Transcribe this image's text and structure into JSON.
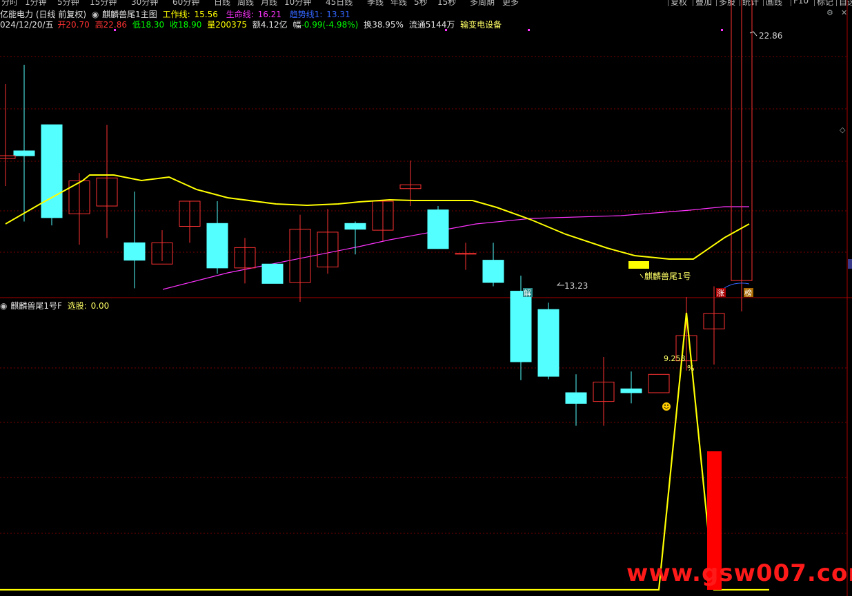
{
  "toolbar": {
    "timeframes": [
      "分时",
      "1分钟",
      "5分钟",
      "15分钟",
      "30分钟",
      "60分钟",
      "日线",
      "周线",
      "月线",
      "10分钟",
      "45日线",
      "季线",
      "年线",
      "5秒",
      "15秒",
      "多周期",
      "更多"
    ],
    "buttons": [
      "复权",
      "叠加",
      "多股",
      "统计",
      "画线",
      "F10",
      "标记",
      "自选"
    ]
  },
  "header": {
    "stock_name": "亿能电力",
    "period": "(日线 前复权)",
    "indicator_name": "麒麟兽尾1主图",
    "lines": [
      {
        "label": "工作线:",
        "value": "15.56",
        "color": "#ffff00"
      },
      {
        "label": "生命线:",
        "value": "16.21",
        "color": "#ff33ff"
      },
      {
        "label": "趋势线1:",
        "value": "13.31",
        "color": "#3366ff"
      }
    ]
  },
  "quote": {
    "date": "024/12/20/五",
    "open_label": "开",
    "open": "20.70",
    "high_label": "高",
    "high": "22.86",
    "low_label": "低",
    "low": "18.30",
    "close_label": "收",
    "close": "18.90",
    "vol_label": "量",
    "vol": "200375",
    "amt_label": "额",
    "amt": "4.12亿",
    "chg_label": "幅",
    "chg": "-0.99(-4.98%)",
    "turnover_label": "换",
    "turnover": "38.95%",
    "float_label": "流通",
    "float": "5144万",
    "industry": "输变电设备"
  },
  "sub_header": {
    "name": "麒麟兽尾1号F",
    "label": "选股:",
    "value": "0.00"
  },
  "colors": {
    "up": "#ff3232",
    "down": "#54ffff",
    "work_line": "#ffff00",
    "life_line": "#ff33ff",
    "trend_line": "#3366ff",
    "grid": "#7a0000",
    "accent_text": "#ffff66"
  },
  "chart_data": [
    {
      "type": "candlestick",
      "candles": [
        {
          "o": 16.55,
          "h": 17.44,
          "l": 15.82,
          "c": 16.5
        },
        {
          "o": 16.82,
          "h": 16.82,
          "l": 15.78,
          "c": 15.86
        },
        {
          "o": 15.9,
          "h": 16.32,
          "l": 15.58,
          "c": 16.24
        },
        {
          "o": 15.98,
          "h": 16.82,
          "l": 15.65,
          "c": 16.27
        },
        {
          "o": 15.6,
          "h": 16.13,
          "l": 15.13,
          "c": 15.42
        },
        {
          "o": 15.38,
          "h": 15.73,
          "l": 15.41,
          "c": 15.6
        },
        {
          "o": 15.77,
          "h": 16.03,
          "l": 15.6,
          "c": 16.03
        },
        {
          "o": 15.8,
          "h": 16.03,
          "l": 15.28,
          "c": 15.34
        },
        {
          "o": 15.34,
          "h": 15.65,
          "l": 15.18,
          "c": 15.55
        },
        {
          "o": 15.38,
          "h": 15.23,
          "l": 15.18,
          "c": 15.18
        },
        {
          "o": 15.19,
          "h": 15.89,
          "l": 14.99,
          "c": 15.74
        },
        {
          "o": 15.35,
          "h": 15.95,
          "l": 15.28,
          "c": 15.71
        },
        {
          "o": 15.8,
          "h": 15.82,
          "l": 15.48,
          "c": 15.74
        },
        {
          "o": 15.73,
          "h": 16.03,
          "l": 15.62,
          "c": 16.03
        },
        {
          "o": 16.16,
          "h": 16.45,
          "l": 15.98,
          "c": 16.2
        },
        {
          "o": 15.94,
          "h": 15.98,
          "l": 15.54,
          "c": 15.54
        },
        {
          "o": 15.49,
          "h": 15.6,
          "l": 15.32,
          "c": 15.49
        },
        {
          "o": 15.42,
          "h": 15.6,
          "l": 15.15,
          "c": 15.19
        },
        {
          "o": 15.1,
          "h": 15.26,
          "l": 14.18,
          "c": 14.37
        },
        {
          "o": 14.91,
          "h": 14.98,
          "l": 14.19,
          "c": 14.22
        },
        {
          "o": 14.05,
          "h": 14.24,
          "l": 13.71,
          "c": 13.94
        },
        {
          "o": 13.96,
          "h": 14.42,
          "l": 13.71,
          "c": 14.16
        },
        {
          "o": 14.09,
          "h": 14.27,
          "l": 13.94,
          "c": 14.05
        },
        {
          "o": 14.05,
          "h": 14.05,
          "l": 14.05,
          "c": 14.24
        },
        {
          "o": 14.38,
          "h": 15.04,
          "l": 14.28,
          "c": 14.64
        },
        {
          "o": 14.71,
          "h": 15.15,
          "l": 14.34,
          "c": 14.87
        },
        {
          "o": 15.21,
          "h": 19.34,
          "l": 14.89,
          "c": 19.34
        },
        {
          "o": 20.7,
          "h": 22.86,
          "l": 18.3,
          "c": 18.9
        }
      ],
      "work_line": [
        15.12,
        15.47,
        15.78,
        16.08,
        16.08,
        15.96,
        16.05,
        15.83,
        15.71,
        15.62,
        15.58,
        15.62,
        15.68,
        15.7,
        15.73,
        15.69,
        15.7,
        15.47,
        15.28,
        15.06,
        14.88,
        14.72,
        14.54,
        14.42,
        14.35,
        14.33,
        14.72,
        15.05
      ],
      "life_line": [
        null,
        null,
        null,
        null,
        null,
        null,
        null,
        null,
        null,
        null,
        null,
        null,
        null,
        null,
        null,
        null,
        null,
        null,
        null,
        null,
        null,
        null,
        null,
        null,
        null,
        null,
        15.34,
        15.33
      ],
      "life_line_from": [
        null,
        null,
        null,
        null,
        null,
        null,
        13.87,
        13.96,
        14.05,
        14.14,
        14.22,
        14.29,
        14.36,
        14.43,
        14.52,
        14.58,
        14.64,
        14.7,
        14.75,
        14.8,
        14.86,
        14.92,
        14.97,
        15.02,
        15.07,
        15.13,
        15.26,
        15.33
      ],
      "annotations": [
        "22.86",
        "13.23",
        "麒麟兽尾1号",
        "解",
        "涨",
        "榜"
      ],
      "value_label": "9.258",
      "unit_label": "%"
    },
    {
      "type": "line",
      "title": "麒麟兽尾1号F",
      "values": [
        0,
        0,
        0,
        0,
        0,
        0,
        0,
        0,
        0,
        0,
        0,
        0,
        0,
        0,
        0,
        0,
        0,
        0,
        0,
        0,
        0,
        0,
        0,
        0,
        1,
        0,
        0,
        0
      ],
      "bar_values": [
        0,
        0,
        0,
        0,
        0,
        0,
        0,
        0,
        0,
        0,
        0,
        0,
        0,
        0,
        0,
        0,
        0,
        0,
        0,
        0,
        0,
        0,
        0,
        0,
        0,
        0.5,
        0,
        0
      ]
    }
  ],
  "watermark": "www.gsw007.com"
}
